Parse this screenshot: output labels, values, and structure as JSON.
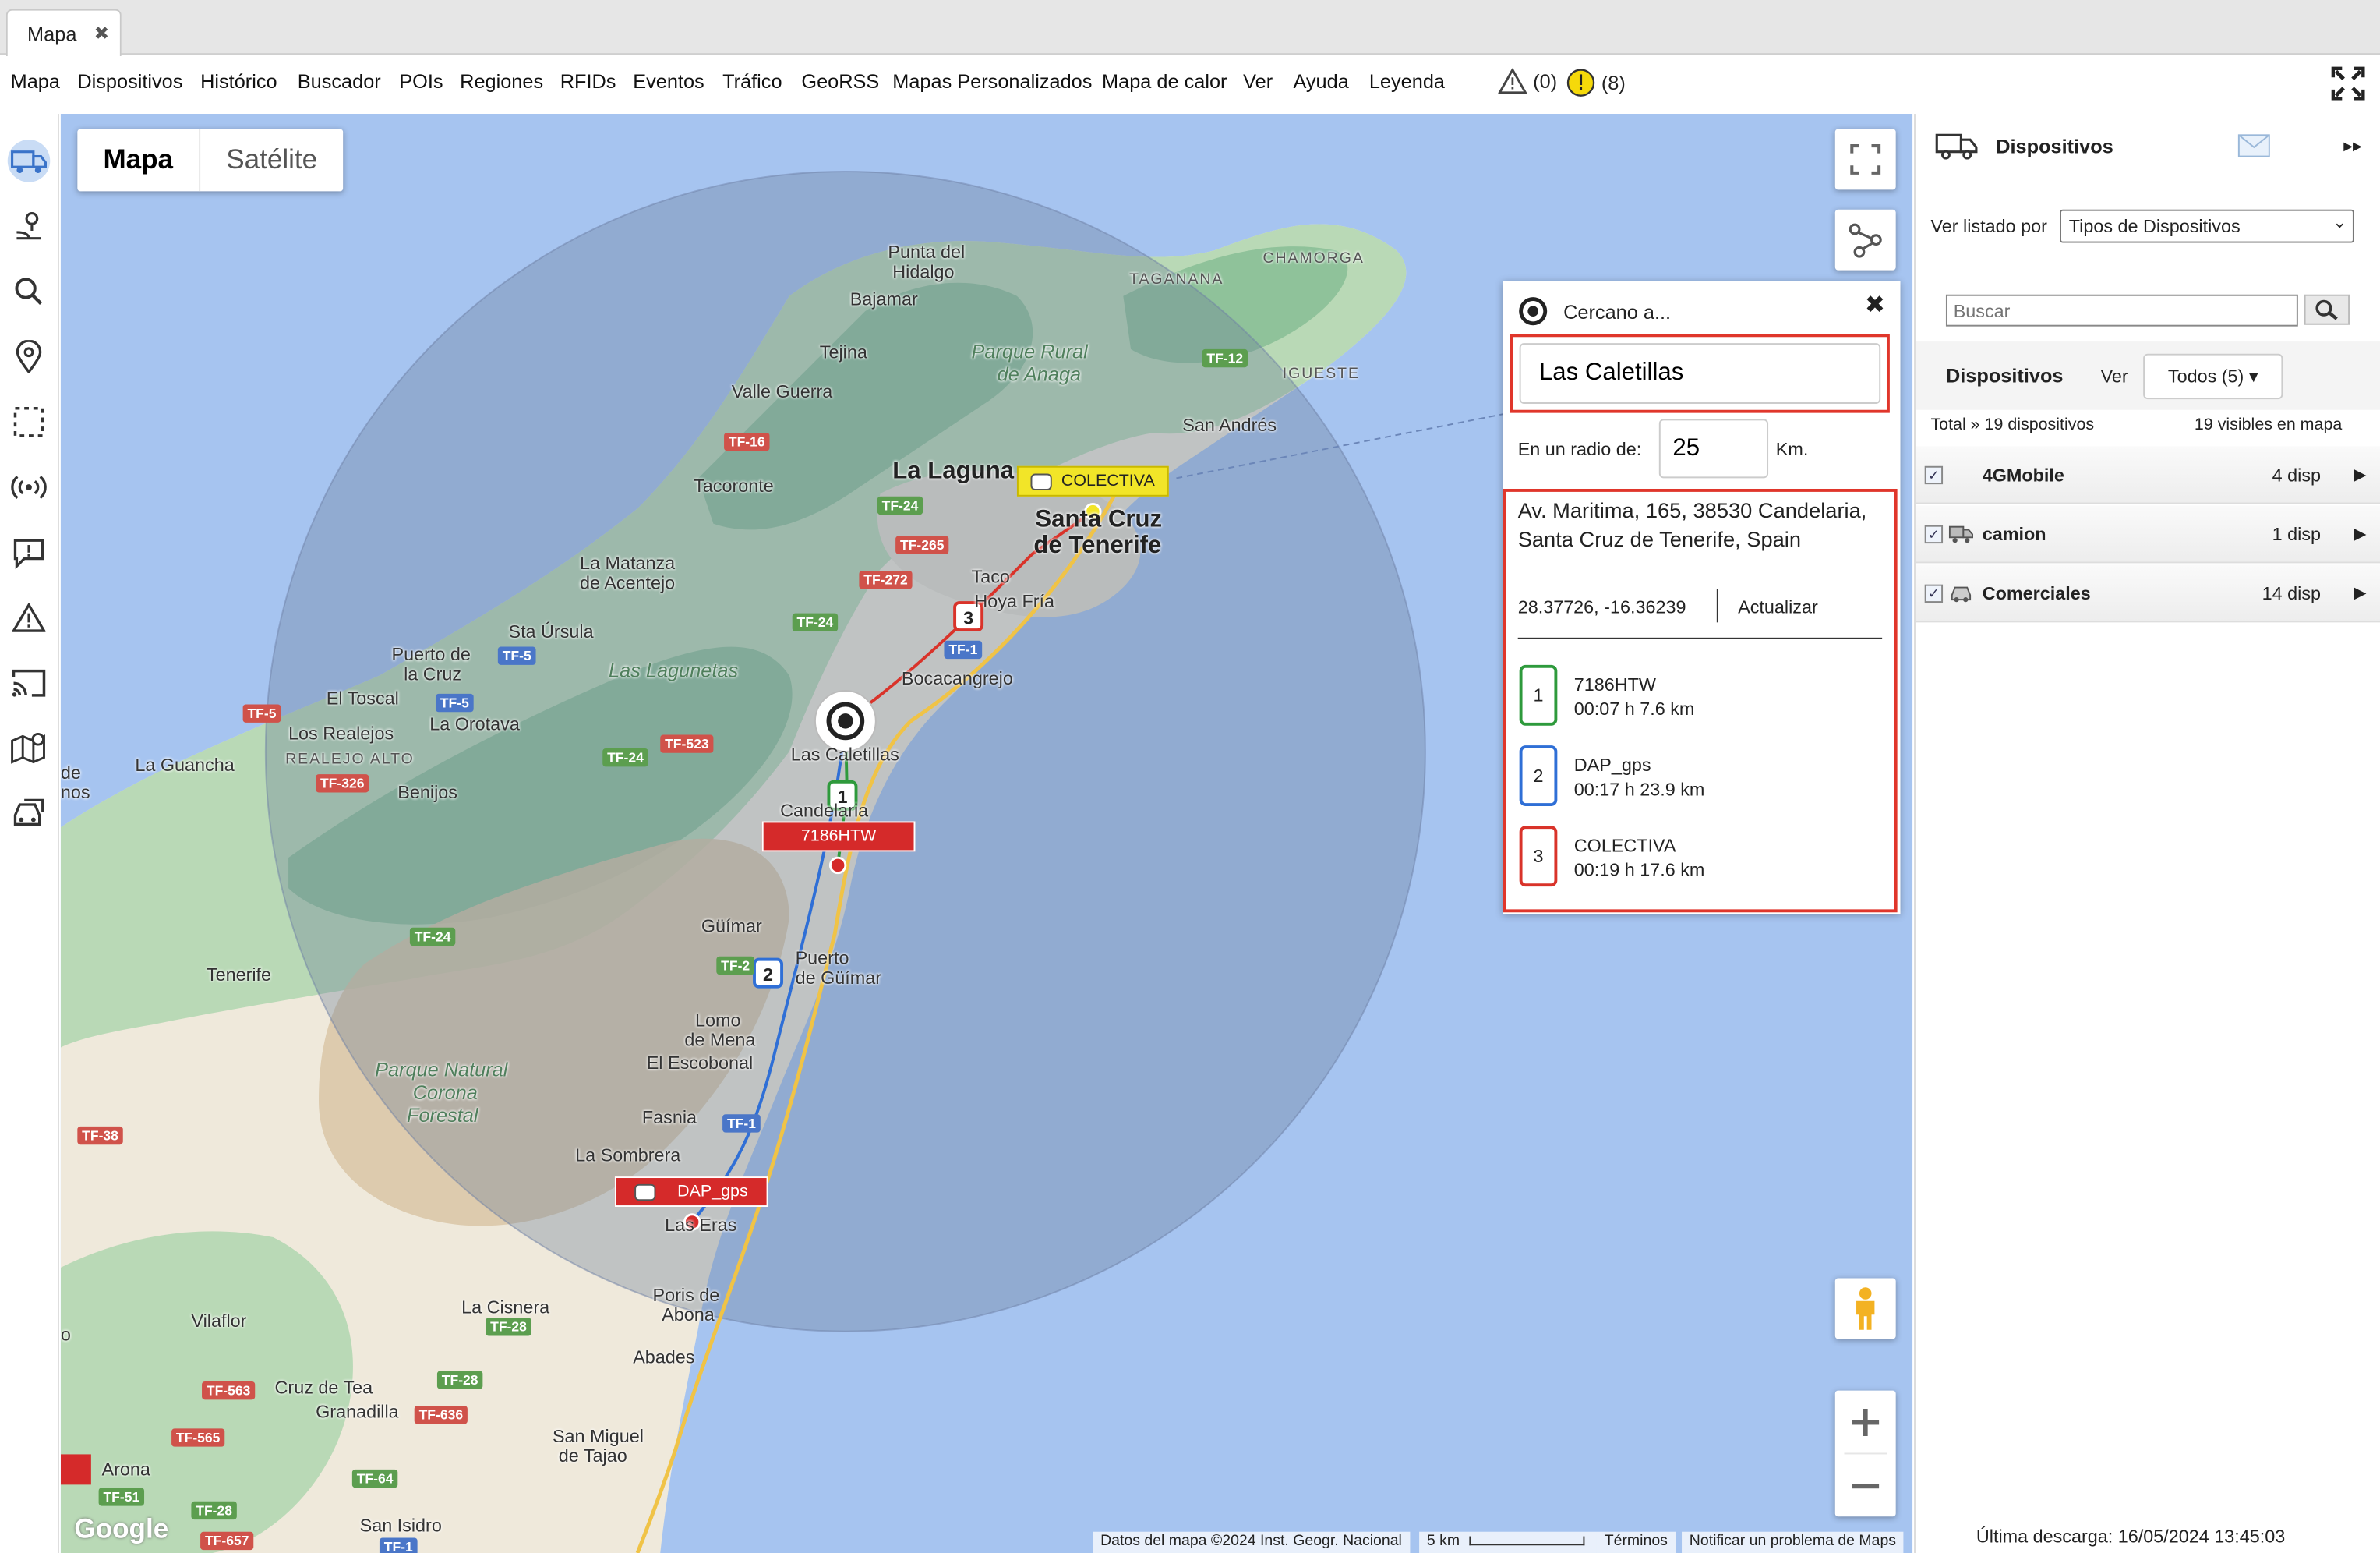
{
  "tab": {
    "title": "Mapa",
    "close_glyph": "✖"
  },
  "menu": [
    "Mapa",
    "Dispositivos",
    "Histórico",
    "Buscador",
    "POIs",
    "Regiones",
    "RFIDs",
    "Eventos",
    "Tráfico",
    "GeoRSS",
    "Mapas Personalizados",
    "Mapa de calor",
    "Ver",
    "Ayuda",
    "Leyenda"
  ],
  "alerts": {
    "warning_count": "(0)",
    "info_count": "(8)"
  },
  "left_tools": [
    "truck-icon",
    "route-icon",
    "search-icon",
    "pin-icon",
    "selection-icon",
    "antenna-icon",
    "message-icon",
    "warning-icon",
    "cast-icon",
    "map-pin-icon",
    "traffic-icon"
  ],
  "map": {
    "type_map": "Mapa",
    "type_sat": "Satélite",
    "places": [
      {
        "t": "Punta del",
        "c": ""
      },
      {
        "t": "Hidalgo",
        "c": ""
      },
      {
        "t": "Bajamar",
        "c": ""
      },
      {
        "t": "Tejina",
        "c": ""
      },
      {
        "t": "Valle Guerra",
        "c": ""
      },
      {
        "t": "Tacoronte",
        "c": ""
      },
      {
        "t": "La Laguna",
        "c": "big"
      },
      {
        "t": "Santa Cruz",
        "c": "big"
      },
      {
        "t": "de Tenerife",
        "c": "big"
      },
      {
        "t": "La Matanza",
        "c": ""
      },
      {
        "t": "de Acentejo",
        "c": ""
      },
      {
        "t": "Sta Úrsula",
        "c": ""
      },
      {
        "t": "Taco",
        "c": ""
      },
      {
        "t": "Hoya Fría",
        "c": ""
      },
      {
        "t": "Bocacangrejo",
        "c": ""
      },
      {
        "t": "Puerto de",
        "c": ""
      },
      {
        "t": "la Cruz",
        "c": ""
      },
      {
        "t": "El Toscal",
        "c": ""
      },
      {
        "t": "La Orotava",
        "c": ""
      },
      {
        "t": "Los Realejos",
        "c": ""
      },
      {
        "t": "REALEJO ALTO",
        "c": "small"
      },
      {
        "t": "La Guancha",
        "c": ""
      },
      {
        "t": "Benijos",
        "c": ""
      },
      {
        "t": "Las Caletillas",
        "c": ""
      },
      {
        "t": "Candelaria",
        "c": ""
      },
      {
        "t": "Güímar",
        "c": ""
      },
      {
        "t": "Puerto",
        "c": ""
      },
      {
        "t": "de Güímar",
        "c": ""
      },
      {
        "t": "Tenerife",
        "c": ""
      },
      {
        "t": "Lomo",
        "c": ""
      },
      {
        "t": "de Mena",
        "c": ""
      },
      {
        "t": "El Escobonal",
        "c": ""
      },
      {
        "t": "Fasnia",
        "c": ""
      },
      {
        "t": "La Sombrera",
        "c": ""
      },
      {
        "t": "Las Eras",
        "c": ""
      },
      {
        "t": "Poris de",
        "c": ""
      },
      {
        "t": "Abona",
        "c": ""
      },
      {
        "t": "La Cisnera",
        "c": ""
      },
      {
        "t": "Abades",
        "c": ""
      },
      {
        "t": "Vilaflor",
        "c": ""
      },
      {
        "t": "Cruz de Tea",
        "c": ""
      },
      {
        "t": "Granadilla",
        "c": ""
      },
      {
        "t": "San Miguel",
        "c": ""
      },
      {
        "t": "de Tajao",
        "c": ""
      },
      {
        "t": "Arona",
        "c": ""
      },
      {
        "t": "San Isidro",
        "c": ""
      },
      {
        "t": "TAGANANA",
        "c": "small"
      },
      {
        "t": "CHAMORGA",
        "c": "small"
      },
      {
        "t": "IGUESTE",
        "c": "small"
      },
      {
        "t": "San Andrés",
        "c": ""
      },
      {
        "t": "Parque Rural",
        "c": "park"
      },
      {
        "t": "de Anaga",
        "c": "park"
      },
      {
        "t": "Las Lagunetas",
        "c": "park"
      },
      {
        "t": "Parque Natural",
        "c": "park"
      },
      {
        "t": "Corona",
        "c": "park"
      },
      {
        "t": "Forestal",
        "c": "park"
      },
      {
        "t": "de",
        "c": ""
      },
      {
        "t": "nos",
        "c": ""
      },
      {
        "t": "o",
        "c": ""
      }
    ],
    "roads": [
      {
        "t": "TF-12",
        "c": "g"
      },
      {
        "t": "TF-16",
        "c": "r"
      },
      {
        "t": "TF-24",
        "c": "g"
      },
      {
        "t": "TF-265",
        "c": "r"
      },
      {
        "t": "TF-272",
        "c": "r"
      },
      {
        "t": "TF-24",
        "c": "g"
      },
      {
        "t": "TF-5",
        "c": "b"
      },
      {
        "t": "TF-5",
        "c": "b"
      },
      {
        "t": "TF-5",
        "c": "r"
      },
      {
        "t": "TF-523",
        "c": "r"
      },
      {
        "t": "TF-24",
        "c": "g"
      },
      {
        "t": "TF-326",
        "c": "r"
      },
      {
        "t": "TF-1",
        "c": "b"
      },
      {
        "t": "TF-24",
        "c": "g"
      },
      {
        "t": "TF-2",
        "c": "g"
      },
      {
        "t": "TF-1",
        "c": "b"
      },
      {
        "t": "TF-38",
        "c": "r"
      },
      {
        "t": "TF-28",
        "c": "g"
      },
      {
        "t": "TF-28",
        "c": "g"
      },
      {
        "t": "TF-563",
        "c": "r"
      },
      {
        "t": "TF-636",
        "c": "r"
      },
      {
        "t": "TF-565",
        "c": "r"
      },
      {
        "t": "TF-64",
        "c": "g"
      },
      {
        "t": "TF-28",
        "c": "g"
      },
      {
        "t": "TF-51",
        "c": "g"
      },
      {
        "t": "TF-657",
        "c": "r"
      },
      {
        "t": "TF-1",
        "c": "b"
      }
    ],
    "vehicles": [
      "COLECTIVA",
      "7186HTW",
      "DAP_gps"
    ],
    "route_markers": [
      "1",
      "2",
      "3"
    ],
    "attribution": {
      "data": "Datos del mapa ©2024 Inst. Geogr. Nacional",
      "scale": "5 km",
      "terms": "Términos",
      "report": "Notificar un problema de Maps"
    },
    "google": "Google"
  },
  "nearby": {
    "title": "Cercano a...",
    "close": "✖",
    "search_value": "Las Caletillas",
    "radius_label": "En un radio de:",
    "radius_value": "25",
    "radius_unit": "Km.",
    "address": "Av. Maritima, 165, 38530 Candelaria, Santa Cruz de Tenerife, Spain",
    "coords": "28.37726, -16.36239",
    "update": "Actualizar",
    "results": [
      {
        "num": "1",
        "name": "7186HTW",
        "info": "00:07 h 7.6 km",
        "color": "#2e9a3c"
      },
      {
        "num": "2",
        "name": "DAP_gps",
        "info": "00:17 h 23.9 km",
        "color": "#2f6fd6"
      },
      {
        "num": "3",
        "name": "COLECTIVA",
        "info": "00:19 h 17.6 km",
        "color": "#d9332a"
      }
    ]
  },
  "devices": {
    "title": "Dispositivos",
    "collapse": "▸▸",
    "list_by_label": "Ver listado por",
    "list_by_value": "Tipos de Dispositivos",
    "search_placeholder": "Buscar",
    "subtitle": "Dispositivos",
    "ver": "Ver",
    "filter": "Todos (5) ▾",
    "total": "Total » 19 dispositivos",
    "visible": "19 visibles en mapa",
    "groups": [
      {
        "name": "4GMobile",
        "count": "4 disp"
      },
      {
        "name": "camion",
        "count": "1 disp"
      },
      {
        "name": "Comerciales",
        "count": "14 disp"
      }
    ],
    "last_download": "Última descarga: 16/05/2024 13:45:03"
  }
}
